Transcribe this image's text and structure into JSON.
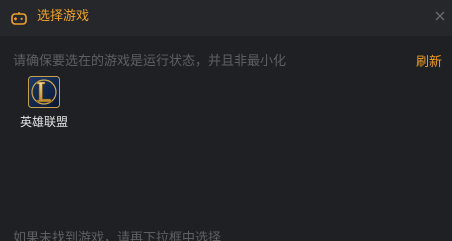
{
  "dialog": {
    "title": "选择游戏",
    "title_icon": "gamepad-icon",
    "close_icon": "close-icon",
    "accent_color": "#f0a227",
    "background_color": "#1f2024",
    "titlebar_color": "#26272b"
  },
  "content": {
    "hint": "请确保要选在的游戏是运行状态，并且非最小化",
    "refresh_label": "刷新",
    "bottom_hint": "如果未找到游戏，请再下拉框中选择"
  },
  "games": [
    {
      "label": "英雄联盟",
      "icon": "league-of-legends-icon"
    }
  ]
}
